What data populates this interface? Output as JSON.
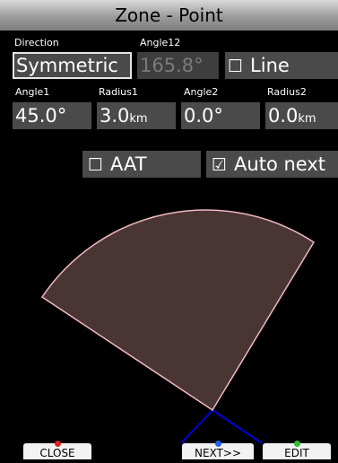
{
  "header": {
    "title": "Zone - Point"
  },
  "form": {
    "direction": {
      "label": "Direction",
      "value": "Symmetric"
    },
    "angle12": {
      "label": "Angle12",
      "value": "165.8°"
    },
    "line": {
      "box": "☐",
      "label": "Line"
    },
    "angle1": {
      "label": "Angle1",
      "value": "45.0°"
    },
    "radius1": {
      "label": "Radius1",
      "value": "3.0",
      "unit": "km"
    },
    "angle2": {
      "label": "Angle2",
      "value": "0.0°"
    },
    "radius2": {
      "label": "Radius2",
      "value": "0.0",
      "unit": "km"
    },
    "aat": {
      "box": "☐",
      "label": "AAT"
    },
    "auto_next": {
      "box": "☑",
      "label": "Auto next"
    }
  },
  "footer": {
    "close_label": "CLOSE",
    "next_label": "NEXT>>",
    "edit_label": "EDIT"
  },
  "colors": {
    "sector_fill": "#4a3535",
    "sector_stroke": "#f0b8c0",
    "course_line": "#0000e0",
    "close_dot": "#e02020",
    "next_dot": "#2060ff",
    "edit_dot": "#30c030"
  }
}
